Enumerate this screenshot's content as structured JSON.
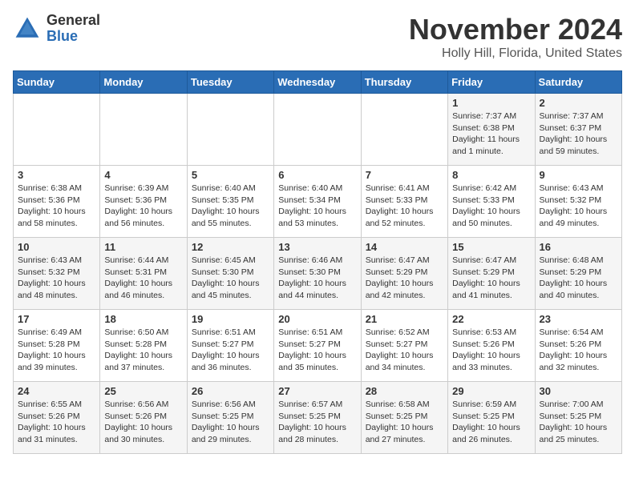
{
  "header": {
    "logo_general": "General",
    "logo_blue": "Blue",
    "month": "November 2024",
    "location": "Holly Hill, Florida, United States"
  },
  "weekdays": [
    "Sunday",
    "Monday",
    "Tuesday",
    "Wednesday",
    "Thursday",
    "Friday",
    "Saturday"
  ],
  "weeks": [
    [
      {
        "day": "",
        "info": ""
      },
      {
        "day": "",
        "info": ""
      },
      {
        "day": "",
        "info": ""
      },
      {
        "day": "",
        "info": ""
      },
      {
        "day": "",
        "info": ""
      },
      {
        "day": "1",
        "info": "Sunrise: 7:37 AM\nSunset: 6:38 PM\nDaylight: 11 hours and 1 minute."
      },
      {
        "day": "2",
        "info": "Sunrise: 7:37 AM\nSunset: 6:37 PM\nDaylight: 10 hours and 59 minutes."
      }
    ],
    [
      {
        "day": "3",
        "info": "Sunrise: 6:38 AM\nSunset: 5:36 PM\nDaylight: 10 hours and 58 minutes."
      },
      {
        "day": "4",
        "info": "Sunrise: 6:39 AM\nSunset: 5:36 PM\nDaylight: 10 hours and 56 minutes."
      },
      {
        "day": "5",
        "info": "Sunrise: 6:40 AM\nSunset: 5:35 PM\nDaylight: 10 hours and 55 minutes."
      },
      {
        "day": "6",
        "info": "Sunrise: 6:40 AM\nSunset: 5:34 PM\nDaylight: 10 hours and 53 minutes."
      },
      {
        "day": "7",
        "info": "Sunrise: 6:41 AM\nSunset: 5:33 PM\nDaylight: 10 hours and 52 minutes."
      },
      {
        "day": "8",
        "info": "Sunrise: 6:42 AM\nSunset: 5:33 PM\nDaylight: 10 hours and 50 minutes."
      },
      {
        "day": "9",
        "info": "Sunrise: 6:43 AM\nSunset: 5:32 PM\nDaylight: 10 hours and 49 minutes."
      }
    ],
    [
      {
        "day": "10",
        "info": "Sunrise: 6:43 AM\nSunset: 5:32 PM\nDaylight: 10 hours and 48 minutes."
      },
      {
        "day": "11",
        "info": "Sunrise: 6:44 AM\nSunset: 5:31 PM\nDaylight: 10 hours and 46 minutes."
      },
      {
        "day": "12",
        "info": "Sunrise: 6:45 AM\nSunset: 5:30 PM\nDaylight: 10 hours and 45 minutes."
      },
      {
        "day": "13",
        "info": "Sunrise: 6:46 AM\nSunset: 5:30 PM\nDaylight: 10 hours and 44 minutes."
      },
      {
        "day": "14",
        "info": "Sunrise: 6:47 AM\nSunset: 5:29 PM\nDaylight: 10 hours and 42 minutes."
      },
      {
        "day": "15",
        "info": "Sunrise: 6:47 AM\nSunset: 5:29 PM\nDaylight: 10 hours and 41 minutes."
      },
      {
        "day": "16",
        "info": "Sunrise: 6:48 AM\nSunset: 5:29 PM\nDaylight: 10 hours and 40 minutes."
      }
    ],
    [
      {
        "day": "17",
        "info": "Sunrise: 6:49 AM\nSunset: 5:28 PM\nDaylight: 10 hours and 39 minutes."
      },
      {
        "day": "18",
        "info": "Sunrise: 6:50 AM\nSunset: 5:28 PM\nDaylight: 10 hours and 37 minutes."
      },
      {
        "day": "19",
        "info": "Sunrise: 6:51 AM\nSunset: 5:27 PM\nDaylight: 10 hours and 36 minutes."
      },
      {
        "day": "20",
        "info": "Sunrise: 6:51 AM\nSunset: 5:27 PM\nDaylight: 10 hours and 35 minutes."
      },
      {
        "day": "21",
        "info": "Sunrise: 6:52 AM\nSunset: 5:27 PM\nDaylight: 10 hours and 34 minutes."
      },
      {
        "day": "22",
        "info": "Sunrise: 6:53 AM\nSunset: 5:26 PM\nDaylight: 10 hours and 33 minutes."
      },
      {
        "day": "23",
        "info": "Sunrise: 6:54 AM\nSunset: 5:26 PM\nDaylight: 10 hours and 32 minutes."
      }
    ],
    [
      {
        "day": "24",
        "info": "Sunrise: 6:55 AM\nSunset: 5:26 PM\nDaylight: 10 hours and 31 minutes."
      },
      {
        "day": "25",
        "info": "Sunrise: 6:56 AM\nSunset: 5:26 PM\nDaylight: 10 hours and 30 minutes."
      },
      {
        "day": "26",
        "info": "Sunrise: 6:56 AM\nSunset: 5:25 PM\nDaylight: 10 hours and 29 minutes."
      },
      {
        "day": "27",
        "info": "Sunrise: 6:57 AM\nSunset: 5:25 PM\nDaylight: 10 hours and 28 minutes."
      },
      {
        "day": "28",
        "info": "Sunrise: 6:58 AM\nSunset: 5:25 PM\nDaylight: 10 hours and 27 minutes."
      },
      {
        "day": "29",
        "info": "Sunrise: 6:59 AM\nSunset: 5:25 PM\nDaylight: 10 hours and 26 minutes."
      },
      {
        "day": "30",
        "info": "Sunrise: 7:00 AM\nSunset: 5:25 PM\nDaylight: 10 hours and 25 minutes."
      }
    ]
  ]
}
